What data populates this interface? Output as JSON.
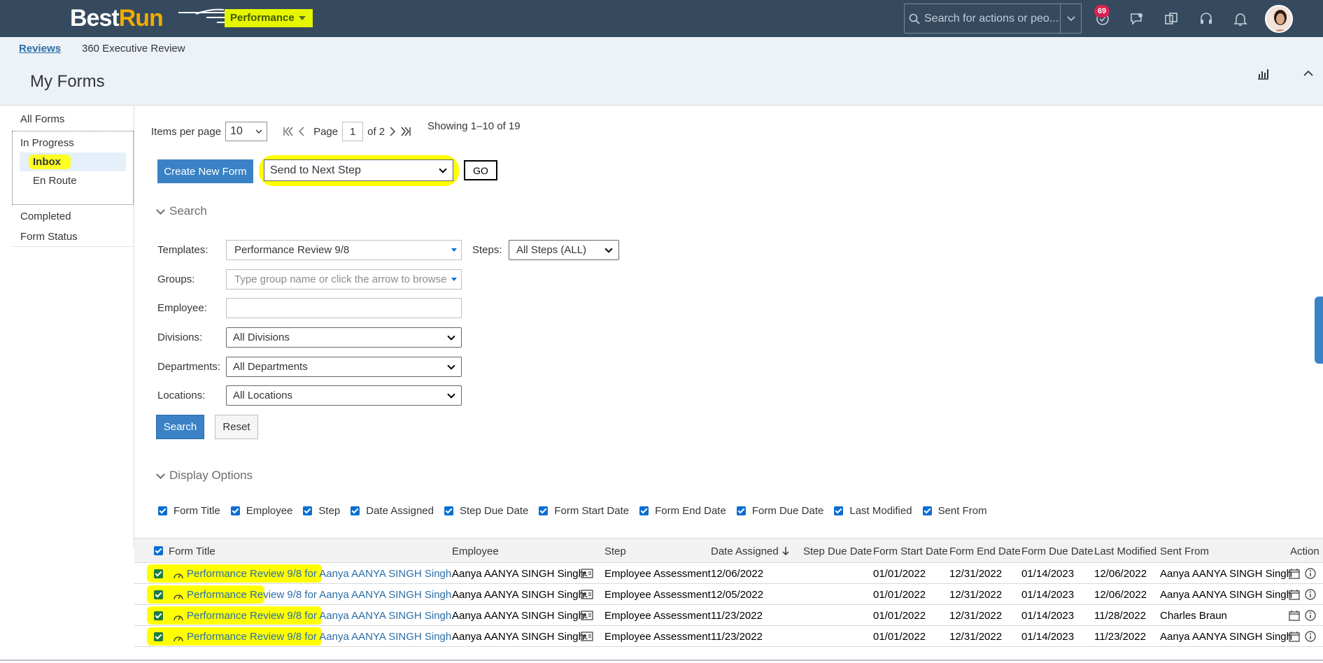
{
  "shell": {
    "logo_best": "Best",
    "logo_run": "Run",
    "module": "Performance",
    "search_placeholder": "Search for actions or peo...",
    "notification_count": "69"
  },
  "breadcrumb": {
    "link": "Reviews",
    "current": "360 Executive Review"
  },
  "page_title": "My Forms",
  "leftnav": {
    "all_forms": "All Forms",
    "in_progress": "In Progress",
    "inbox": "Inbox",
    "en_route": "En Route",
    "completed": "Completed",
    "form_status": "Form Status"
  },
  "pager": {
    "items_label": "Items per page",
    "items_value": "10",
    "page_label": "Page",
    "page_value": "1",
    "of_label": "of 2",
    "showing": "Showing 1–10 of 19"
  },
  "actions": {
    "create": "Create New Form",
    "bulk_action": "Send to Next Step",
    "go": "GO"
  },
  "search": {
    "toggle": "Search",
    "templates_label": "Templates:",
    "templates_value": "Performance Review 9/8",
    "steps_label": "Steps:",
    "steps_value": "All Steps (ALL)",
    "groups_label": "Groups:",
    "groups_placeholder": "Type group name or click the arrow to browse",
    "employee_label": "Employee:",
    "divisions_label": "Divisions:",
    "divisions_value": "All Divisions",
    "departments_label": "Departments:",
    "departments_value": "All Departments",
    "locations_label": "Locations:",
    "locations_value": "All Locations",
    "search_btn": "Search",
    "reset_btn": "Reset"
  },
  "display_options": {
    "toggle": "Display Options",
    "items": [
      "Form Title",
      "Employee",
      "Step",
      "Date Assigned",
      "Step Due Date",
      "Form Start Date",
      "Form End Date",
      "Form Due Date",
      "Last Modified",
      "Sent From"
    ]
  },
  "table": {
    "headers": [
      "Form Title",
      "Employee",
      "Step",
      "Date Assigned",
      "Step Due Date",
      "Form Start Date",
      "Form End Date",
      "Form Due Date",
      "Last Modified",
      "Sent From",
      "Action"
    ],
    "rows": [
      {
        "title": "Performance Review 9/8 for Aanya AANYA SINGH Singh",
        "employee": "Aanya AANYA SINGH Singh",
        "step": "Employee Assessment",
        "assigned": "12/06/2022",
        "start": "01/01/2022",
        "end": "12/31/2022",
        "due": "01/14/2023",
        "modified": "12/06/2022",
        "sent_from": "Aanya AANYA SINGH Singh"
      },
      {
        "title": "Performance Review 9/8 for Aanya AANYA SINGH Singh",
        "employee": "Aanya AANYA SINGH Singh",
        "step": "Employee Assessment",
        "assigned": "12/05/2022",
        "start": "01/01/2022",
        "end": "12/31/2022",
        "due": "01/14/2023",
        "modified": "12/06/2022",
        "sent_from": "Aanya AANYA SINGH Singh"
      },
      {
        "title": "Performance Review 9/8 for Aanya AANYA SINGH Singh",
        "employee": "Aanya AANYA SINGH Singh",
        "step": "Employee Assessment",
        "assigned": "11/23/2022",
        "start": "01/01/2022",
        "end": "12/31/2022",
        "due": "01/14/2023",
        "modified": "11/28/2022",
        "sent_from": "Charles Braun"
      },
      {
        "title": "Performance Review 9/8 for Aanya AANYA SINGH Singh",
        "employee": "Aanya AANYA SINGH Singh",
        "step": "Employee Assessment",
        "assigned": "11/23/2022",
        "start": "01/01/2022",
        "end": "12/31/2022",
        "due": "01/14/2023",
        "modified": "11/23/2022",
        "sent_from": "Aanya AANYA SINGH Singh"
      }
    ]
  },
  "colors": {
    "shell": "#354a5f",
    "accent": "#3a82c5",
    "highlight": "#ffff00",
    "link": "#2b6ea8"
  }
}
